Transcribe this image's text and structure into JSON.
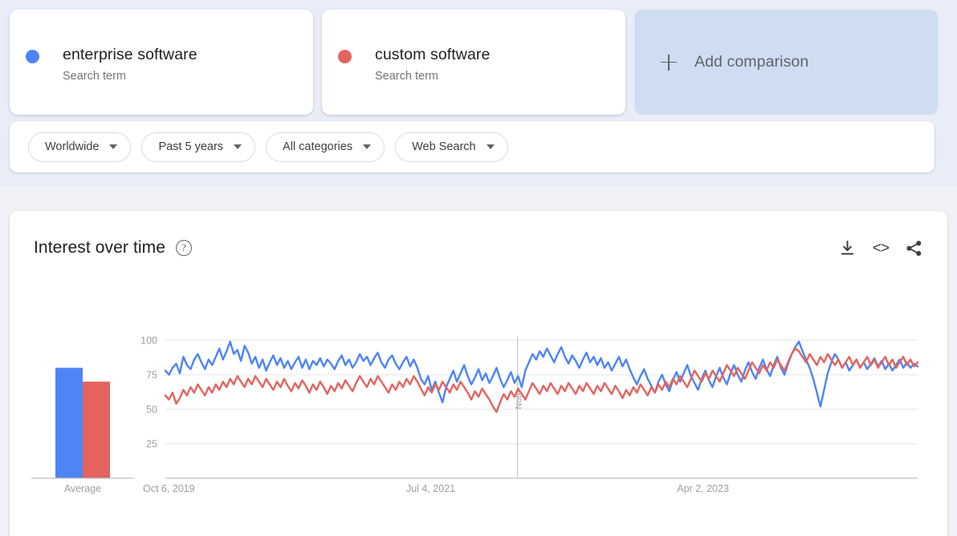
{
  "terms": [
    {
      "label": "enterprise software",
      "sub": "Search term",
      "color": "#4e84f5"
    },
    {
      "label": "custom software",
      "sub": "Search term",
      "color": "#e3645f"
    }
  ],
  "add_comparison": {
    "label": "Add comparison",
    "icon": "plus-icon"
  },
  "filters": [
    {
      "label": "Worldwide",
      "icon": "chevron-down-icon"
    },
    {
      "label": "Past 5 years",
      "icon": "chevron-down-icon"
    },
    {
      "label": "All categories",
      "icon": "chevron-down-icon"
    },
    {
      "label": "Web Search",
      "icon": "chevron-down-icon"
    }
  ],
  "panel": {
    "title": "Interest over time",
    "help_icon": "?",
    "actions": [
      {
        "name": "download-icon",
        "label": "Download"
      },
      {
        "name": "embed-icon",
        "label": "<>"
      },
      {
        "name": "share-icon",
        "label": "Share"
      }
    ]
  },
  "chart_data": {
    "type": "line",
    "title": "Interest over time",
    "xlabel": "",
    "ylabel": "",
    "ylim": [
      0,
      105
    ],
    "yticks": [
      25,
      50,
      75,
      100
    ],
    "ytick_labels": [
      "25",
      "50",
      "75",
      "100"
    ],
    "grid": true,
    "legend_position": "cards-above",
    "xtick_labels": [
      "Oct 6, 2019",
      "Jul 4, 2021",
      "Apr 2, 2023"
    ],
    "xtick_fracs": [
      0.0,
      0.35,
      0.71
    ],
    "annotations": [
      {
        "label": "Note",
        "x_frac": 0.468,
        "type": "vertical-line"
      }
    ],
    "average_bar": {
      "label": "Average",
      "values": [
        80,
        70
      ],
      "series_names": [
        "enterprise software",
        "custom software"
      ],
      "colors": [
        "#4e84f5",
        "#e3645f"
      ]
    },
    "series": [
      {
        "name": "enterprise software",
        "color": "#4e84f5",
        "values": [
          78,
          75,
          80,
          83,
          76,
          88,
          82,
          79,
          86,
          90,
          84,
          79,
          86,
          82,
          88,
          94,
          86,
          92,
          99,
          90,
          93,
          85,
          96,
          91,
          83,
          88,
          80,
          86,
          78,
          84,
          89,
          82,
          87,
          80,
          85,
          79,
          84,
          88,
          80,
          86,
          79,
          85,
          82,
          87,
          81,
          86,
          83,
          79,
          85,
          89,
          82,
          86,
          80,
          84,
          90,
          85,
          88,
          82,
          87,
          91,
          84,
          80,
          86,
          89,
          83,
          79,
          84,
          88,
          81,
          86,
          80,
          72,
          68,
          74,
          64,
          70,
          62,
          55,
          66,
          72,
          78,
          70,
          76,
          82,
          74,
          68,
          73,
          79,
          71,
          76,
          69,
          74,
          80,
          72,
          66,
          71,
          77,
          69,
          74,
          66,
          78,
          84,
          90,
          86,
          92,
          88,
          94,
          89,
          84,
          90,
          95,
          88,
          83,
          89,
          85,
          80,
          86,
          91,
          84,
          88,
          82,
          87,
          80,
          84,
          78,
          83,
          88,
          81,
          86,
          79,
          73,
          68,
          74,
          79,
          72,
          67,
          62,
          70,
          75,
          68,
          63,
          71,
          77,
          70,
          76,
          82,
          74,
          69,
          64,
          72,
          78,
          71,
          66,
          74,
          80,
          73,
          68,
          76,
          82,
          75,
          70,
          78,
          84,
          77,
          72,
          80,
          86,
          79,
          74,
          82,
          88,
          80,
          75,
          83,
          90,
          95,
          99,
          92,
          86,
          80,
          72,
          62,
          52,
          64,
          76,
          84,
          90,
          86,
          80,
          84,
          78,
          82,
          86,
          80,
          84,
          79,
          83,
          87,
          81,
          85,
          79,
          83,
          78,
          82,
          86,
          80,
          84,
          80,
          83,
          81
        ]
      },
      {
        "name": "custom software",
        "color": "#e3645f",
        "values": [
          60,
          57,
          62,
          54,
          58,
          64,
          60,
          66,
          62,
          68,
          64,
          60,
          66,
          62,
          68,
          64,
          70,
          66,
          72,
          68,
          74,
          70,
          66,
          72,
          68,
          74,
          70,
          66,
          72,
          68,
          64,
          70,
          66,
          72,
          67,
          63,
          69,
          65,
          71,
          67,
          62,
          68,
          64,
          70,
          66,
          61,
          67,
          63,
          69,
          65,
          71,
          67,
          63,
          69,
          74,
          70,
          66,
          72,
          68,
          74,
          70,
          66,
          62,
          68,
          64,
          70,
          66,
          72,
          68,
          74,
          70,
          65,
          60,
          66,
          62,
          68,
          64,
          70,
          66,
          62,
          68,
          64,
          70,
          66,
          62,
          57,
          63,
          59,
          65,
          61,
          57,
          52,
          48,
          55,
          61,
          57,
          63,
          59,
          65,
          61,
          57,
          63,
          69,
          65,
          61,
          67,
          63,
          69,
          65,
          61,
          67,
          63,
          69,
          65,
          61,
          67,
          63,
          69,
          65,
          61,
          67,
          63,
          69,
          65,
          61,
          67,
          63,
          58,
          64,
          60,
          66,
          62,
          68,
          64,
          60,
          66,
          62,
          68,
          64,
          70,
          66,
          72,
          68,
          74,
          70,
          66,
          72,
          78,
          74,
          70,
          76,
          72,
          78,
          74,
          70,
          76,
          82,
          78,
          74,
          80,
          76,
          72,
          78,
          84,
          80,
          76,
          82,
          78,
          84,
          80,
          86,
          82,
          78,
          84,
          90,
          94,
          92,
          88,
          84,
          90,
          86,
          82,
          88,
          84,
          90,
          86,
          82,
          86,
          80,
          84,
          88,
          82,
          86,
          80,
          84,
          88,
          82,
          86,
          80,
          84,
          88,
          82,
          86,
          80,
          84,
          88,
          82,
          86,
          81,
          84
        ]
      }
    ]
  }
}
